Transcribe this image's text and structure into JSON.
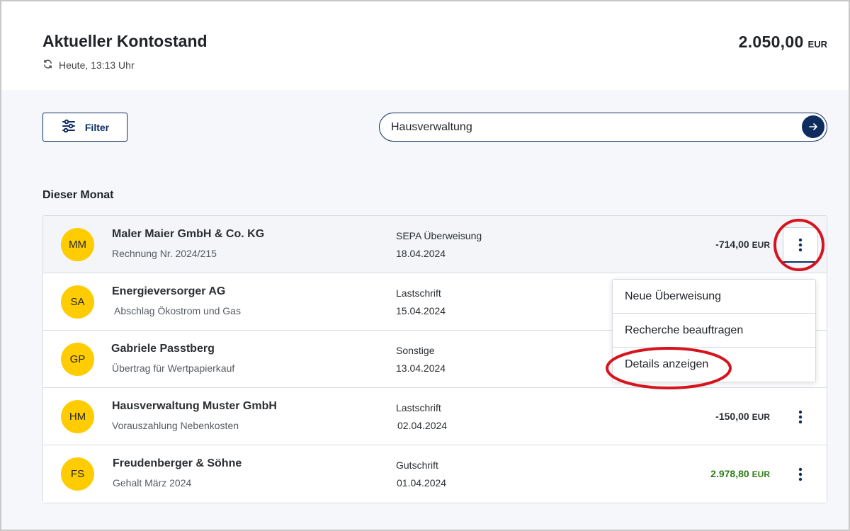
{
  "header": {
    "title": "Aktueller Kontostand",
    "updated": "Heute, 13:13 Uhr",
    "balance": "2.050,00",
    "currency": "EUR"
  },
  "toolbar": {
    "filter_label": "Filter",
    "search_value": "Hausverwaltung"
  },
  "section_title": "Dieser Monat",
  "transactions": [
    {
      "initials": "MM",
      "name": "Maler Maier GmbH & Co. KG",
      "description": "Rechnung Nr. 2024/215",
      "type": "SEPA Überweisung",
      "date": "18.04.2024",
      "amount": "-714,00",
      "currency": "EUR"
    },
    {
      "initials": "SA",
      "name": "Energieversorger AG",
      "description": "Abschlag Ökostrom und Gas",
      "type": "Lastschrift",
      "date": "15.04.2024"
    },
    {
      "initials": "GP",
      "name": "Gabriele Passtberg",
      "description": "Übertrag für Wertpapierkauf",
      "type": "Sonstige",
      "date": "13.04.2024"
    },
    {
      "initials": "HM",
      "name": "Hausverwaltung Muster GmbH",
      "description": "Vorauszahlung Nebenkosten",
      "type": "Lastschrift",
      "date": "02.04.2024",
      "amount": "-150,00",
      "currency": "EUR"
    },
    {
      "initials": "FS",
      "name": "Freudenberger & Söhne",
      "description": "Gehalt März 2024",
      "type": "Gutschrift",
      "date": "01.04.2024",
      "amount": "2.978,80",
      "currency": "EUR"
    }
  ],
  "context_menu": {
    "items": [
      "Neue Überweisung",
      "Recherche beauftragen",
      "Details anzeigen"
    ]
  },
  "colors": {
    "accent": "#0f2c5f",
    "avatar": "#ffcc00",
    "positive_amount": "#2e7d16",
    "annotation": "#d6141e"
  }
}
